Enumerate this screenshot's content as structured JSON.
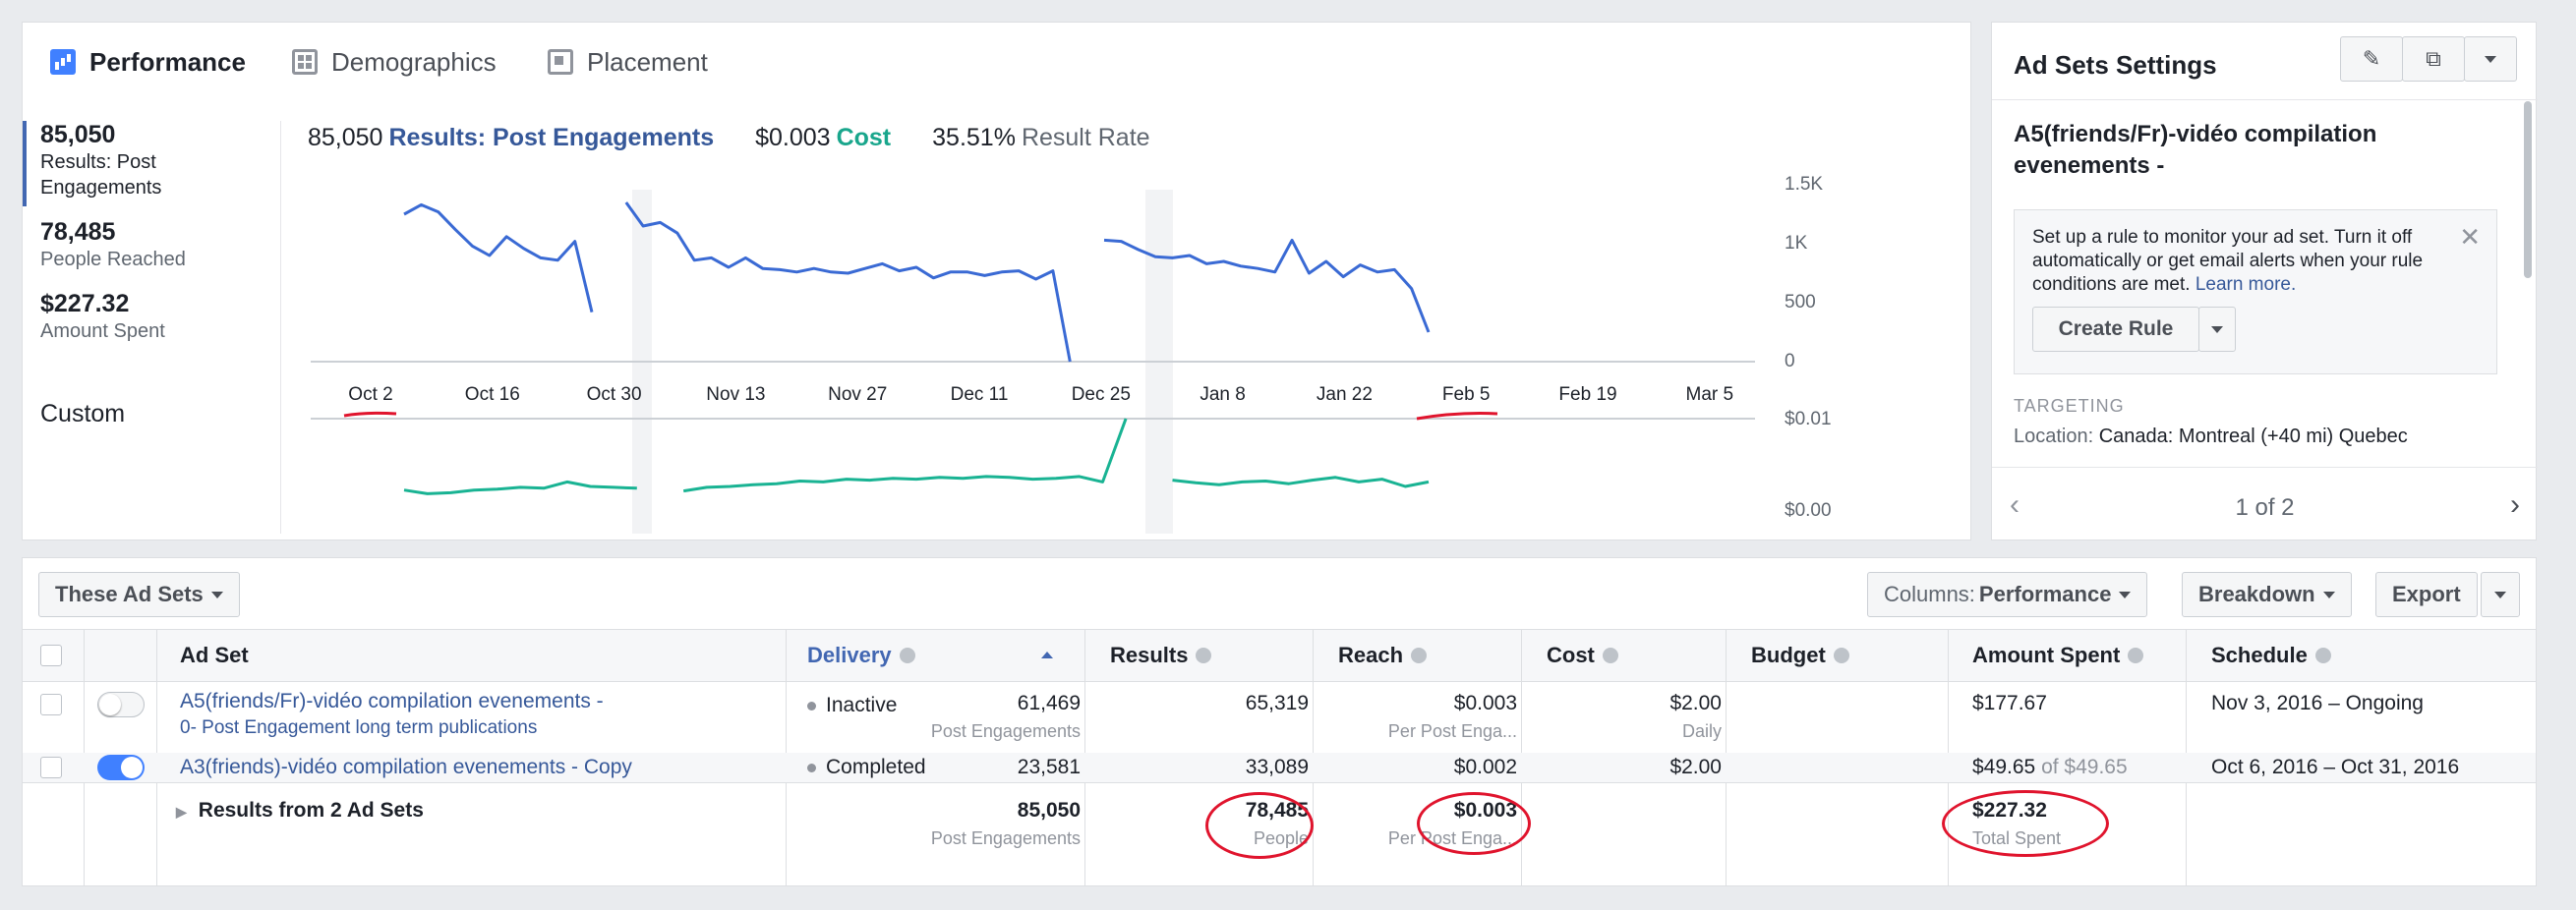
{
  "tabs": [
    {
      "label": "Performance",
      "icon": "bar-chart-icon",
      "active": true
    },
    {
      "label": "Demographics",
      "icon": "grid-icon",
      "active": false
    },
    {
      "label": "Placement",
      "icon": "placement-icon",
      "active": false
    }
  ],
  "metrics": [
    {
      "value": "85,050",
      "label": "Results: Post Engagements"
    },
    {
      "value": "78,485",
      "label": "People Reached"
    },
    {
      "value": "$227.32",
      "label": "Amount Spent"
    }
  ],
  "custom_label": "Custom",
  "summary": {
    "results_value": "85,050",
    "results_label": "Results: Post Engagements",
    "cost_value": "$0.003",
    "cost_label": "Cost",
    "rate_value": "35.51%",
    "rate_label": "Result Rate"
  },
  "chart_data": [
    {
      "type": "line",
      "series": [
        {
          "values": [
            1250,
            1330,
            1270,
            1120,
            980,
            900,
            1060,
            960,
            880,
            860,
            1020,
            420,
            null,
            1350,
            1150,
            1180,
            1090,
            860,
            880,
            800,
            880,
            790,
            780,
            760,
            790,
            760,
            750,
            790,
            830,
            770,
            800,
            710,
            760,
            760,
            730,
            760,
            770,
            700,
            770,
            0,
            null,
            1030,
            1020,
            950,
            890,
            880,
            900,
            830,
            850,
            810,
            790,
            760,
            1030,
            750,
            850,
            720,
            820,
            760,
            780,
            620,
            250
          ]
        }
      ],
      "color": "#3a6ad4",
      "x_ticks": [
        "Oct 2",
        "Oct 16",
        "Oct 30",
        "Nov 13",
        "Nov 27",
        "Dec 11",
        "Dec 25",
        "Jan 8",
        "Jan 22",
        "Feb 5",
        "Feb 19",
        "Mar 5"
      ],
      "y_ticks": [
        "1.5K",
        "1K",
        "500",
        "0"
      ],
      "ylim": [
        0,
        1500
      ]
    },
    {
      "type": "line",
      "series": [
        {
          "values": [
            0.0021,
            0.0017,
            0.0018,
            0.0021,
            0.0022,
            0.0024,
            0.0023,
            0.003,
            0.0025,
            0.0024,
            0.0023,
            null,
            0.002,
            0.0024,
            0.0025,
            0.0027,
            0.0028,
            0.0031,
            0.003,
            0.0033,
            0.0032,
            0.0034,
            0.0033,
            0.0035,
            0.0034,
            0.0036,
            0.0035,
            0.0033,
            0.0034,
            0.0036,
            0.003,
            0.01,
            null,
            0.0032,
            0.0029,
            0.0027,
            0.003,
            0.0031,
            0.0028,
            0.0032,
            0.0035,
            0.003,
            0.0033,
            0.0025,
            0.003
          ]
        }
      ],
      "color": "#19b393",
      "y_ticks": [
        "$0.01",
        "$0.00"
      ],
      "ylim": [
        0,
        0.01
      ]
    }
  ],
  "settings": {
    "title": "Ad Sets Settings",
    "adset_name": "A5(friends/Fr)-vidéo compilation evenements -",
    "rule_text": "Set up a rule to monitor your ad set. Turn it off automatically or get email alerts when your rule conditions are met.",
    "learn_more": "Learn more.",
    "create_rule": "Create Rule",
    "targeting_heading": "TARGETING",
    "location_key": "Location:",
    "location_value": "Canada: Montreal (+40 mi) Quebec",
    "pager": "1 of 2"
  },
  "toolbar": {
    "these_ad_sets": "These Ad Sets",
    "columns_prefix": "Columns:",
    "columns_value": "Performance",
    "breakdown": "Breakdown",
    "export": "Export"
  },
  "table": {
    "headers": {
      "ad_set": "Ad Set",
      "delivery": "Delivery",
      "results": "Results",
      "reach": "Reach",
      "cost": "Cost",
      "budget": "Budget",
      "amount_spent": "Amount Spent",
      "schedule": "Schedule"
    },
    "rows": [
      {
        "name": "A5(friends/Fr)-vidéo compilation evenements -",
        "subname": "0- Post Engagement long term publications",
        "delivery": "Inactive",
        "results": "61,469",
        "results_sub": "Post Engagements",
        "reach": "65,319",
        "cost": "$0.003",
        "cost_sub": "Per Post Enga...",
        "budget": "$2.00",
        "budget_sub": "Daily",
        "amount_spent": "$177.67",
        "schedule": "Nov 3, 2016 – Ongoing"
      },
      {
        "name": "A3(friends)-vidéo compilation evenements - Copy",
        "delivery": "Completed",
        "results": "23,581",
        "reach": "33,089",
        "cost": "$0.002",
        "budget": "$2.00",
        "amount_spent": "$49.65",
        "amount_spent_of": "of $49.65",
        "schedule": "Oct 6, 2016 – Oct 31, 2016"
      }
    ],
    "totals": {
      "label": "Results from 2 Ad Sets",
      "results": "85,050",
      "results_sub": "Post Engagements",
      "reach": "78,485",
      "reach_sub": "People",
      "cost": "$0.003",
      "cost_sub": "Per Post Enga...",
      "amount_spent": "$227.32",
      "amount_spent_sub": "Total Spent"
    }
  }
}
